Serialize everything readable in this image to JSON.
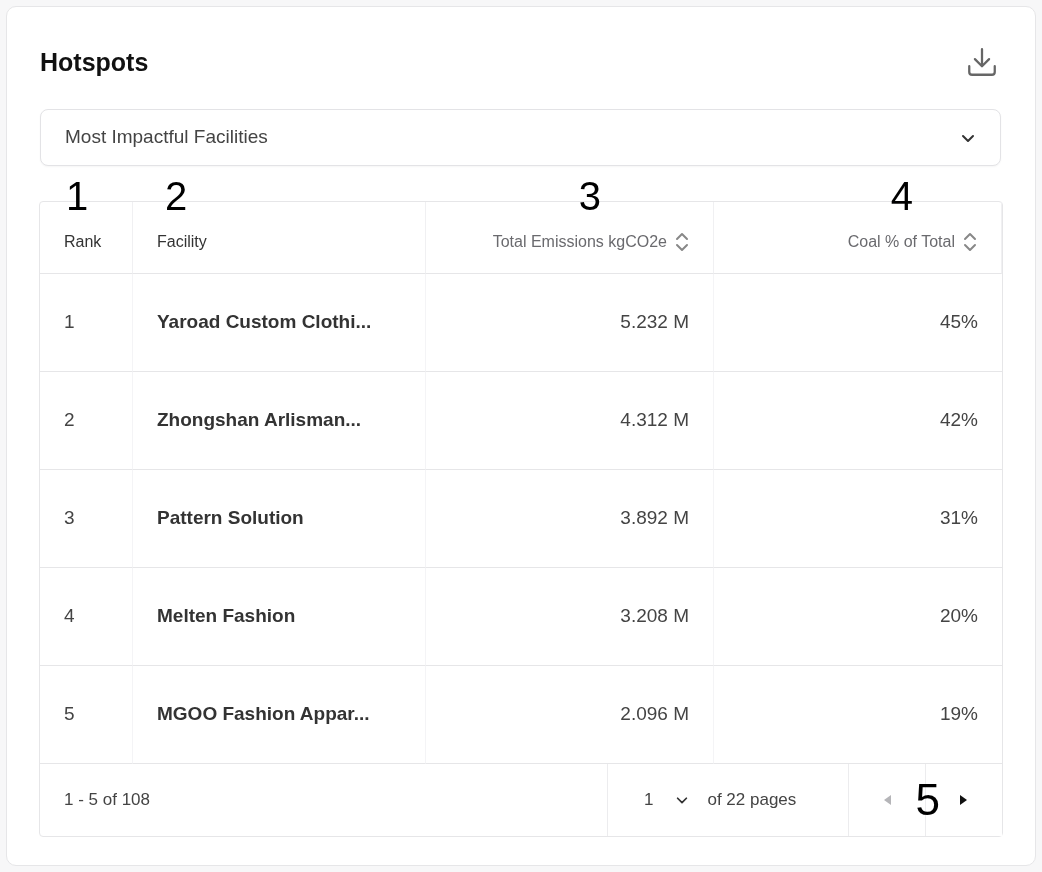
{
  "card": {
    "title": "Hotspots"
  },
  "dropdown": {
    "value": "Most Impactful Facilities"
  },
  "table": {
    "columns": [
      {
        "label": "Rank",
        "sortable": false,
        "annotation": "1"
      },
      {
        "label": "Facility",
        "sortable": false,
        "annotation": "2"
      },
      {
        "label": "Total Emissions kgCO2e",
        "sortable": true,
        "annotation": "3"
      },
      {
        "label": "Coal % of Total",
        "sortable": true,
        "annotation": "4"
      }
    ],
    "rows": [
      [
        "1",
        "Yaroad Custom Clothi...",
        "5.232 M",
        "45%"
      ],
      [
        "2",
        "Zhongshan Arlisman...",
        "4.312 M",
        "42%"
      ],
      [
        "3",
        "Pattern Solution",
        "3.892 M",
        "31%"
      ],
      [
        "4",
        "Melten Fashion",
        "3.208 M",
        "20%"
      ],
      [
        "5",
        "MGOO Fashion Appar...",
        "2.096 M",
        "19%"
      ]
    ]
  },
  "pagination": {
    "range": "1 - 5 of 108",
    "page": "1",
    "of_pages": "of 22 pages",
    "prev_disabled": true,
    "next_disabled": false,
    "annotation": "5"
  }
}
